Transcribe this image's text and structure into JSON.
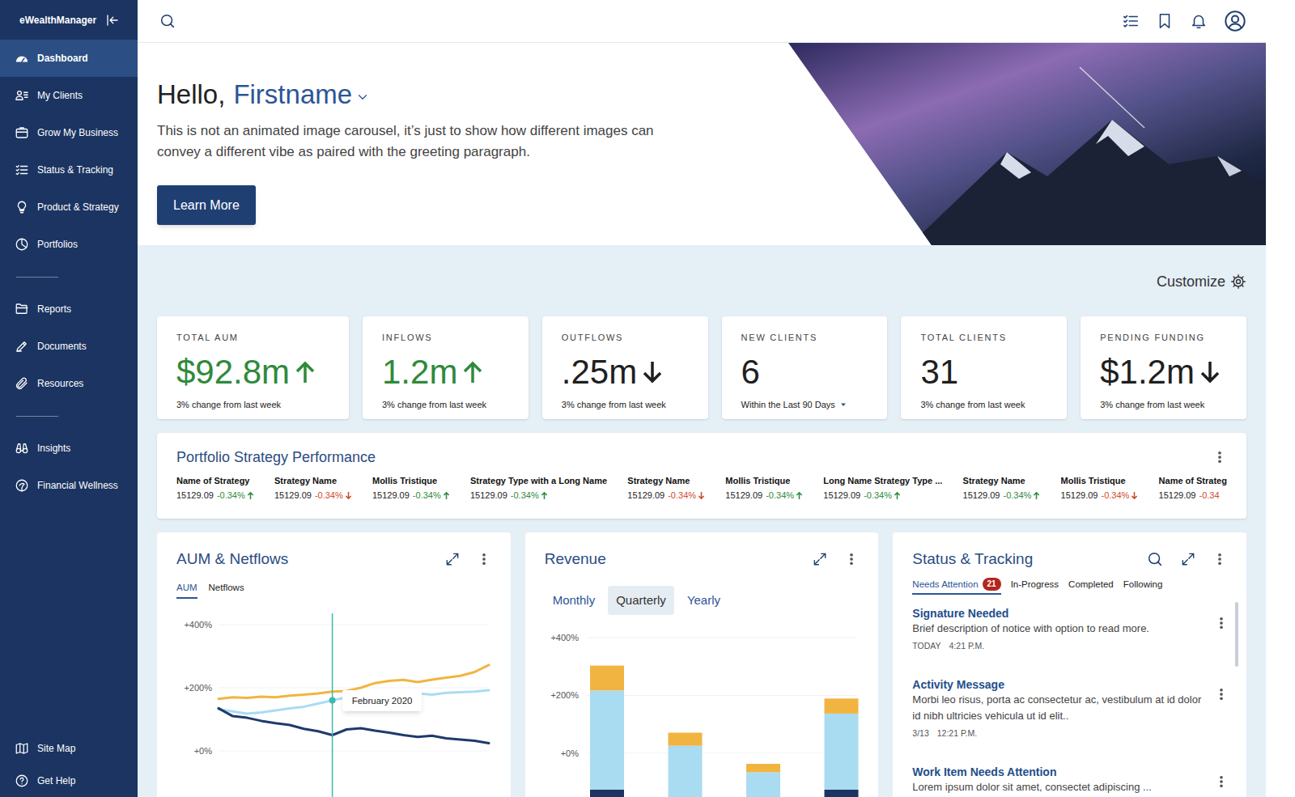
{
  "app": {
    "name": "eWealthManager"
  },
  "sidebar": {
    "groups": [
      [
        {
          "label": "Dashboard",
          "selected": true
        },
        {
          "label": "My Clients",
          "selected": false
        },
        {
          "label": "Grow My Business",
          "selected": false
        },
        {
          "label": "Status & Tracking",
          "selected": false
        },
        {
          "label": "Product & Strategy",
          "selected": false
        },
        {
          "label": "Portfolios",
          "selected": false
        }
      ],
      [
        {
          "label": "Reports",
          "selected": false
        },
        {
          "label": "Documents",
          "selected": false
        },
        {
          "label": "Resources",
          "selected": false
        }
      ],
      [
        {
          "label": "Insights",
          "selected": false
        },
        {
          "label": "Financial Wellness",
          "selected": false
        }
      ]
    ],
    "footer": [
      {
        "label": "Site Map"
      },
      {
        "label": "Get Help"
      }
    ]
  },
  "greeting": {
    "hello": "Hello,",
    "name": "Firstname",
    "text": "This is not an animated image carousel, it’s just to show how different images can convey a different vibe as paired with the greeting paragraph.",
    "button": "Learn More"
  },
  "customize": "Customize",
  "kpis": [
    {
      "label": "TOTAL AUM",
      "value": "$92.8m",
      "trend": "up",
      "note": "3% change from last week",
      "dropdown": false
    },
    {
      "label": "INFLOWS",
      "value": "1.2m",
      "trend": "up",
      "note": "3% change from last week",
      "dropdown": false
    },
    {
      "label": "OUTFLOWS",
      "value": ".25m",
      "trend": "down",
      "note": "3% change from last week",
      "dropdown": false
    },
    {
      "label": "NEW CLIENTS",
      "value": "6",
      "trend": "none",
      "note": "Within the Last 90 Days",
      "dropdown": true
    },
    {
      "label": "TOTAL CLIENTS",
      "value": "31",
      "trend": "none",
      "note": "3% change from last week",
      "dropdown": false
    },
    {
      "label": "PENDING FUNDING",
      "value": "$1.2m",
      "trend": "down",
      "note": "3% change from last week",
      "dropdown": false
    }
  ],
  "strategy_performance": {
    "title": "Portfolio Strategy Performance",
    "items": [
      {
        "name": "Name of Strategy",
        "value": "15129.09",
        "change": "-0.34%",
        "direction": "up",
        "arrow": true
      },
      {
        "name": "Strategy Name",
        "value": "15129.09",
        "change": "-0.34%",
        "direction": "down",
        "arrow": true
      },
      {
        "name": "Mollis Tristique",
        "value": "15129.09",
        "change": "-0.34%",
        "direction": "up",
        "arrow": true
      },
      {
        "name": "Strategy Type with a Long Name",
        "value": "15129.09",
        "change": "-0.34%",
        "direction": "up",
        "arrow": true
      },
      {
        "name": "Strategy Name",
        "value": "15129.09",
        "change": "-0.34%",
        "direction": "down",
        "arrow": true
      },
      {
        "name": "Mollis Tristique",
        "value": "15129.09",
        "change": "-0.34%",
        "direction": "up",
        "arrow": true
      },
      {
        "name": "Long Name Strategy Type ...",
        "value": "15129.09",
        "change": "-0.34%",
        "direction": "up",
        "arrow": true
      },
      {
        "name": "Strategy Name",
        "value": "15129.09",
        "change": "-0.34%",
        "direction": "up",
        "arrow": true
      },
      {
        "name": "Mollis Tristique",
        "value": "15129.09",
        "change": "-0.34%",
        "direction": "down",
        "arrow": true
      },
      {
        "name": "Name of Strateg",
        "value": "15129.09",
        "change": "-0.34",
        "direction": "down",
        "arrow": false
      }
    ]
  },
  "aum_chart": {
    "title": "AUM & Netflows",
    "tabs": [
      {
        "label": "AUM",
        "selected": true
      },
      {
        "label": "Netflows",
        "selected": false
      }
    ],
    "ticks": [
      {
        "label": "+400%",
        "value": 400
      },
      {
        "label": "+200%",
        "value": 200
      },
      {
        "label": "+0%",
        "value": 0
      }
    ],
    "series": [
      {
        "color": "#f2b440",
        "values": [
          165,
          170,
          168,
          172,
          170,
          175,
          178,
          182,
          188,
          190,
          200,
          215,
          222,
          225,
          218,
          226,
          232,
          238,
          250,
          272
        ]
      },
      {
        "color": "#a9dcf1",
        "values": [
          132,
          125,
          118,
          122,
          128,
          135,
          140,
          150,
          160,
          170,
          175,
          178,
          176,
          180,
          182,
          178,
          184,
          186,
          188,
          192
        ]
      },
      {
        "color": "#1f3a6b",
        "values": [
          135,
          110,
          105,
          95,
          88,
          82,
          70,
          62,
          50,
          68,
          72,
          64,
          58,
          50,
          44,
          48,
          40,
          36,
          32,
          24
        ]
      }
    ],
    "tooltip": {
      "label": "February 2020",
      "index": 8,
      "dot_series": 1
    }
  },
  "revenue": {
    "title": "Revenue",
    "periods": [
      {
        "label": "Monthly",
        "selected": false
      },
      {
        "label": "Quarterly",
        "selected": true
      },
      {
        "label": "Yearly",
        "selected": false
      }
    ],
    "ticks": [
      {
        "label": "+400%",
        "value": 400
      },
      {
        "label": "+200%",
        "value": 200
      },
      {
        "label": "+0%",
        "value": 0
      }
    ],
    "min": -200,
    "segment_colors": [
      "#1c3461",
      "#a9dcf1",
      "#f2b440"
    ],
    "bars": [
      {
        "segments": [
          74,
          343,
          86
        ]
      },
      {
        "segments": [
          17,
          209,
          45
        ]
      },
      {
        "segments": [
          17,
          117,
          29
        ]
      },
      {
        "segments": [
          74,
          263,
          52
        ]
      }
    ]
  },
  "status_tracking": {
    "title": "Status & Tracking",
    "tabs": [
      {
        "label": "Needs Attention",
        "badge": "21",
        "selected": true
      },
      {
        "label": "In-Progress",
        "selected": false
      },
      {
        "label": "Completed",
        "selected": false
      },
      {
        "label": "Following",
        "selected": false
      }
    ],
    "items": [
      {
        "title": "Signature Needed",
        "text": "Brief description of notice with option to read more.",
        "date": "TODAY",
        "time": "4:21 P.M."
      },
      {
        "title": "Activity Message",
        "text": "Morbi leo risus, porta ac consectetur ac, vestibulum at id dolor id nibh ultricies vehicula ut id elit..",
        "date": "3/13",
        "time": "12:21 P.M."
      },
      {
        "title": "Work Item Needs Attention",
        "text": "Lorem ipsum dolor sit amet, consectet adipiscing ..."
      }
    ]
  }
}
